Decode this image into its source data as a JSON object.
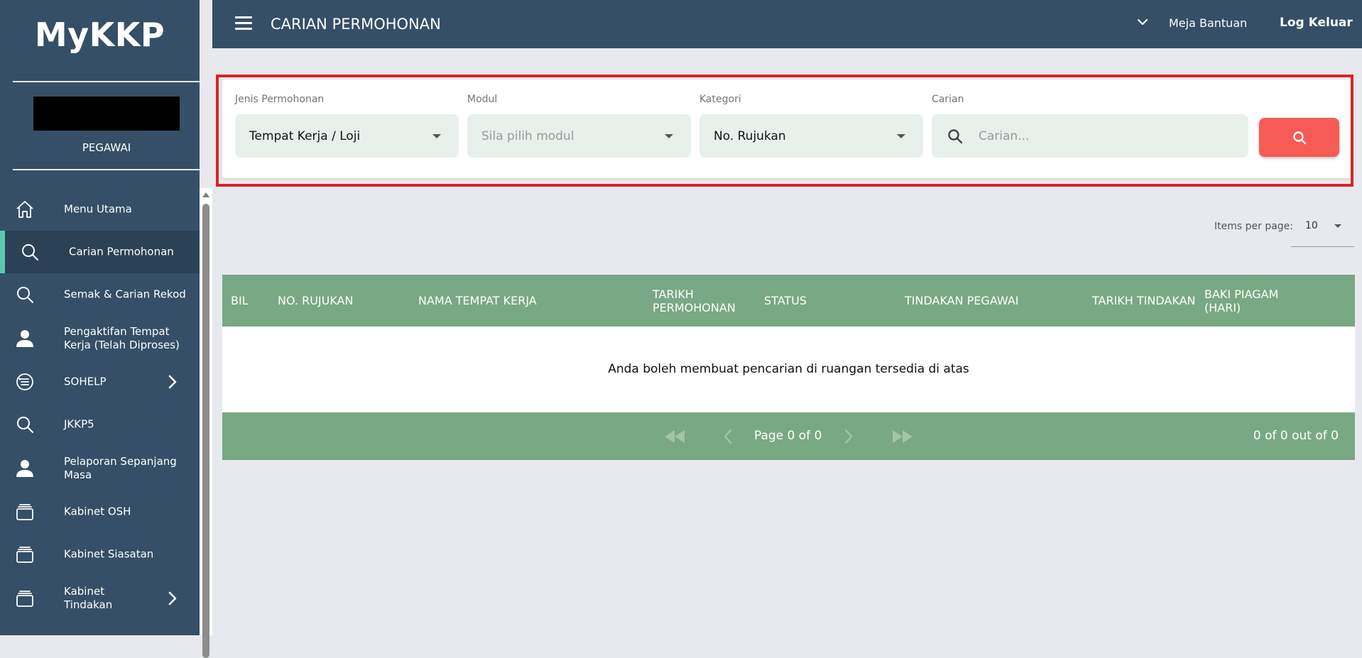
{
  "app": {
    "brand": "MyKKP",
    "role": "PEGAWAI"
  },
  "topbar": {
    "title": "CARIAN PERMOHONAN",
    "help": "Meja Bantuan",
    "logout": "Log Keluar"
  },
  "sidebar": {
    "items": [
      {
        "label": "Menu Utama",
        "icon": "home-icon"
      },
      {
        "label": "Carian Permohonan",
        "icon": "search-icon",
        "active": true
      },
      {
        "label": "Semak & Carian Rekod",
        "icon": "search-icon"
      },
      {
        "label": "Pengaktifan Tempat Kerja (Telah Diproses)",
        "icon": "person-icon"
      },
      {
        "label": "SOHELP",
        "icon": "list-icon",
        "expandable": true
      },
      {
        "label": "JKKP5",
        "icon": "search-icon"
      },
      {
        "label": "Pelaporan Sepanjang Masa",
        "icon": "person-icon"
      },
      {
        "label": "Kabinet OSH",
        "icon": "cabinet-icon"
      },
      {
        "label": "Kabinet Siasatan",
        "icon": "cabinet-icon"
      },
      {
        "label": "Kabinet Tindakan",
        "icon": "cabinet-icon",
        "expandable": true
      }
    ]
  },
  "search": {
    "jenis_label": "Jenis Permohonan",
    "jenis_value": "Tempat Kerja / Loji",
    "modul_label": "Modul",
    "modul_placeholder": "Sila pilih modul",
    "kategori_label": "Kategori",
    "kategori_value": "No. Rujukan",
    "carian_label": "Carian",
    "carian_placeholder": "Carian..."
  },
  "paginator": {
    "items_per_page_label": "Items per page:",
    "items_per_page": "10",
    "page_text": "Page 0 of 0",
    "range_text": "0 of 0 out of 0"
  },
  "table": {
    "columns": [
      "BIL",
      "NO. RUJUKAN",
      "NAMA TEMPAT KERJA",
      "TARIKH PERMOHONAN",
      "STATUS",
      "TINDAKAN PEGAWAI",
      "TARIKH TINDAKAN",
      "BAKI PIAGAM (HARI)"
    ],
    "empty_message": "Anda boleh membuat pencarian di ruangan tersedia di atas"
  },
  "colors": {
    "sidebar": "#344f67",
    "sidebar_active": "#2b4256",
    "active_accent": "#5ec7b2",
    "table_header": "#79a884",
    "search_button": "#f65b55",
    "field_bg": "#e8f0ec",
    "highlight_border": "#d9242a"
  }
}
